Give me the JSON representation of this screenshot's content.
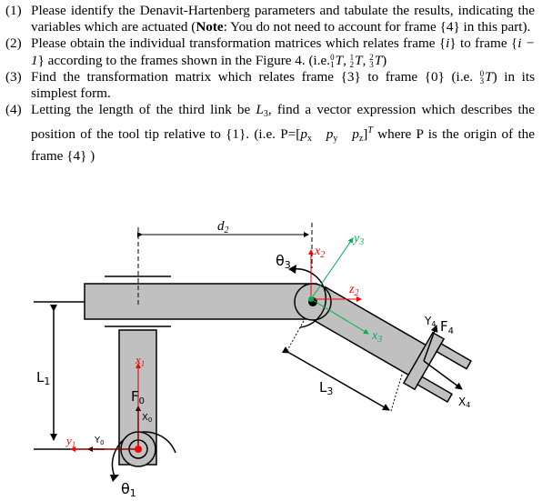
{
  "questions": [
    {
      "number": "(1)",
      "text_a": "Please identify the Denavit-Hartenberg parameters and tabulate the results, indicating the variables which are actuated (",
      "note_label": "Note",
      "text_b": ": You do not need to account for frame {4} in this part)."
    },
    {
      "number": "(2)",
      "text_a": "Please obtain the individual transformation matrices which relates frame {",
      "var_i": "i",
      "text_b": "} to frame {",
      "var_i_minus_1": "i − 1",
      "text_c": "} according to the frames shown in the Figure 4. (i.e.",
      "matrices": [
        {
          "sup": "0",
          "sub": "1",
          "sym": "T"
        },
        {
          "sup": "1",
          "sub": "2",
          "sym": "T"
        },
        {
          "sup": "2",
          "sub": "3",
          "sym": "T"
        }
      ],
      "text_d": ")"
    },
    {
      "number": "(3)",
      "text_a": "Find the transformation matrix which relates frame {3} to frame {0} (i.e. ",
      "matrix": {
        "sup": "0",
        "sub": "3",
        "sym": "T"
      },
      "text_b": ") in its simplest form."
    },
    {
      "number": "(4)",
      "text_a": "Letting the length of the third link be ",
      "link_var": "L",
      "link_sub": "3",
      "text_b": ", find a vector expression which describes the position of the tool tip relative to {1}. (i.e. P=[",
      "px": "p",
      "px_sub": "x",
      "py": "p",
      "py_sub": "y",
      "pz": "p",
      "pz_sub": "z",
      "text_c": "]",
      "transpose": "T",
      "text_d": " where P is the origin of the frame {4} )"
    }
  ],
  "figure": {
    "colors": {
      "link_fill": "#c0c0c0",
      "frame_red": "#ff0000",
      "frame_green": "#00b050",
      "outline": "#000000"
    },
    "labels": {
      "d2": "d",
      "d2_sub": "2",
      "theta3": "θ",
      "theta3_sub": "3",
      "x2": "x",
      "x2_sub": "2",
      "z2": "z",
      "z2_sub": "2",
      "y3": "y",
      "y3_sub": "3",
      "x3": "x",
      "x3_sub": "3",
      "y4": "Y",
      "y4_sub": "4",
      "f4": "F",
      "f4_sub": "4",
      "x4": "X",
      "x4_sub": "4",
      "l1": "L",
      "l1_sub": "1",
      "l3": "L",
      "l3_sub": "3",
      "x1": "x",
      "x1_sub": "1",
      "f0": "F",
      "f0_sub": "0",
      "x0": "X",
      "x0_sub": "0",
      "y1": "y",
      "y1_sub": "1",
      "y0": "Y",
      "y0_sub": "0",
      "theta1": "θ",
      "theta1_sub": "1"
    }
  }
}
